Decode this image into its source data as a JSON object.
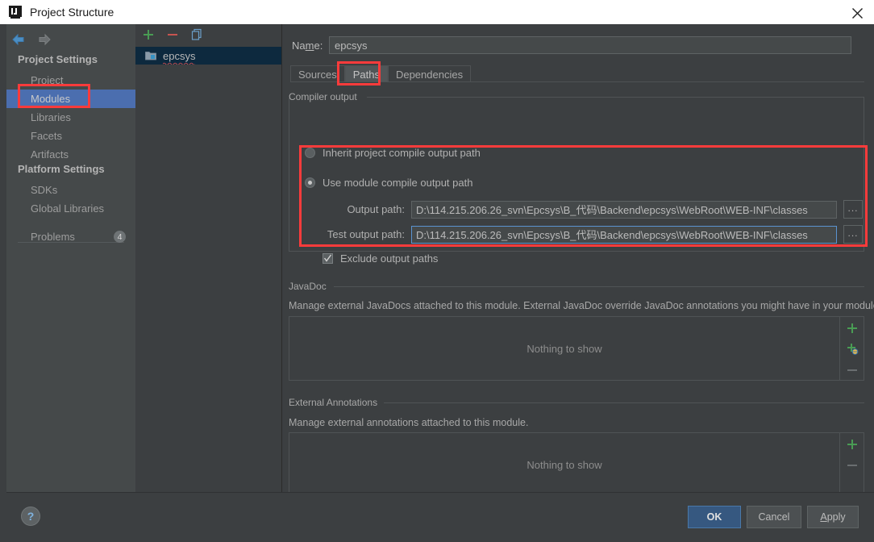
{
  "window": {
    "title": "Project Structure",
    "icon": "intellij-logo-icon",
    "close_label": "×"
  },
  "sidebar": {
    "nav": {
      "back_icon": "arrow-left-icon",
      "forward_icon": "arrow-right-icon"
    },
    "sections": [
      {
        "label": "Project Settings"
      },
      {
        "label": "Platform Settings"
      }
    ],
    "project_settings_items": [
      {
        "label": "Project",
        "selected": false
      },
      {
        "label": "Modules",
        "selected": true
      },
      {
        "label": "Libraries",
        "selected": false
      },
      {
        "label": "Facets",
        "selected": false
      },
      {
        "label": "Artifacts",
        "selected": false
      }
    ],
    "platform_settings_items": [
      {
        "label": "SDKs",
        "selected": false
      },
      {
        "label": "Global Libraries",
        "selected": false
      }
    ],
    "problems": {
      "label": "Problems",
      "count": "4"
    }
  },
  "module_list": {
    "toolbar": {
      "add_icon": "plus-icon",
      "remove_icon": "minus-icon",
      "copy_icon": "copy-icon"
    },
    "modules": [
      {
        "name": "epcsys",
        "icon": "module-icon",
        "selected": true
      }
    ]
  },
  "module_editor": {
    "name_label_prefix": "Na",
    "name_label_mnemonic": "m",
    "name_label_suffix": "e:",
    "name_value": "epcsys",
    "tabs": [
      {
        "label": "Sources",
        "active": false
      },
      {
        "label": "Paths",
        "active": true
      },
      {
        "label": "Dependencies",
        "active": false
      }
    ],
    "compiler_output": {
      "group_title": "Compiler output",
      "inherit_option": {
        "label": "Inherit project compile output path",
        "checked": false
      },
      "module_option": {
        "label": "Use module compile output path",
        "checked": true
      },
      "output_path": {
        "label": "Output path:",
        "value": "D:\\114.215.206.26_svn\\Epcsys\\B_代码\\Backend\\epcsys\\WebRoot\\WEB-INF\\classes",
        "browse_label": "...",
        "focused": false
      },
      "test_output_path": {
        "label": "Test output path:",
        "value": "D:\\114.215.206.26_svn\\Epcsys\\B_代码\\Backend\\epcsys\\WebRoot\\WEB-INF\\classes",
        "browse_label": "...",
        "focused": true
      },
      "exclude_checkbox": {
        "label": "Exclude output paths",
        "checked": true
      }
    },
    "javadoc": {
      "group_title": "JavaDoc",
      "description": "Manage external JavaDocs attached to this module. External JavaDoc override JavaDoc annotations you might have in your module.",
      "empty_text": "Nothing to show",
      "buttons": [
        {
          "icon": "plus-icon",
          "name": "add-javadoc-button"
        },
        {
          "icon": "plus-globe-icon",
          "name": "add-javadoc-url-button"
        },
        {
          "icon": "minus-icon",
          "name": "remove-javadoc-button"
        }
      ]
    },
    "external_annotations": {
      "group_title": "External Annotations",
      "description": "Manage external annotations attached to this module.",
      "empty_text": "Nothing to show",
      "buttons": [
        {
          "icon": "plus-icon",
          "name": "add-annotation-button"
        },
        {
          "icon": "minus-icon",
          "name": "remove-annotation-button"
        }
      ]
    }
  },
  "footer": {
    "help_label": "?",
    "ok_label": "OK",
    "cancel_label": "Cancel",
    "apply_prefix": "",
    "apply_mnemonic": "A",
    "apply_suffix": "pply"
  },
  "annotations": {
    "highlight_color": "#fb3b3b",
    "boxes": [
      {
        "name": "modules-sidebar-highlight"
      },
      {
        "name": "paths-tab-highlight"
      },
      {
        "name": "compiler-output-highlight"
      }
    ]
  },
  "colors": {
    "window_bg": "#3c3f41",
    "sidebar_bg": "#45494a",
    "selection_blue": "#4b6eaf",
    "list_selection": "#0d293e",
    "primary_button": "#365880",
    "accent_green": "#499c54",
    "accent_red": "#c75450"
  }
}
